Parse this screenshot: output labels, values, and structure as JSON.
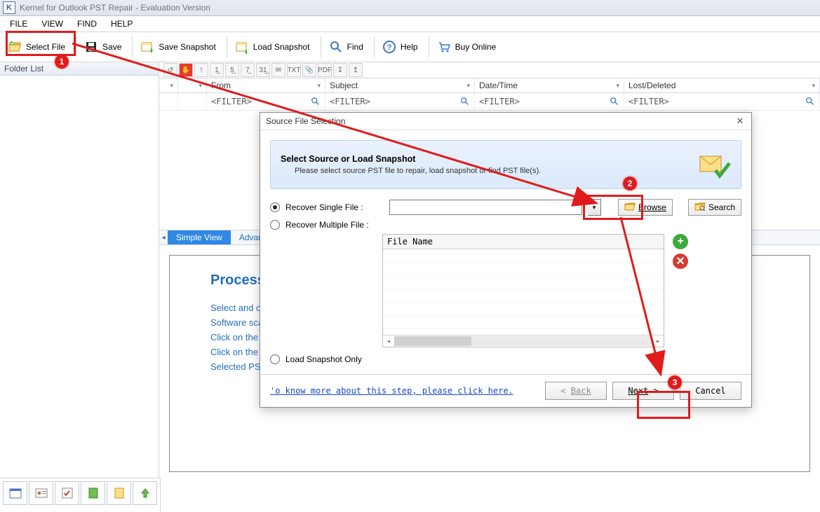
{
  "window": {
    "title": "Kernel for Outlook PST Repair - Evaluation Version",
    "icon_letter": "K"
  },
  "menu": [
    "FILE",
    "VIEW",
    "FIND",
    "HELP"
  ],
  "toolbar": {
    "select_file": "Select File",
    "save": "Save",
    "save_snapshot": "Save Snapshot",
    "load_snapshot": "Load Snapshot",
    "find": "Find",
    "help": "Help",
    "buy_online": "Buy Online"
  },
  "folder_panel": {
    "header": "Folder List"
  },
  "mini_toolbar": [
    "↺",
    "✋",
    "!",
    "1̲",
    "5̲",
    "7̲",
    "31̲",
    "✉",
    "TXT",
    "📎",
    "PDF",
    "↧",
    "↥"
  ],
  "columns": {
    "spacer_a": "",
    "spacer_b": "",
    "from": "From",
    "subject": "Subject",
    "datetime": "Date/Time",
    "lost": "Lost/Deleted"
  },
  "filter_placeholder": "<FILTER>",
  "tabs": {
    "simple": "Simple View",
    "advanced": "Advanced Properties View"
  },
  "process": {
    "title": "Process Information",
    "steps": [
      "Select and click the drive or folder containing PST file.",
      "Software scans the selected source and lists all existing PST files.",
      "Click on the PST file you want to repair.",
      "Click on the Next button to proceed.",
      "Selected PST file(s) will be scanned and listed in tree structure."
    ]
  },
  "modal": {
    "title": "Source File Selection",
    "info_heading": "Select Source or Load Snapshot",
    "info_desc": "Please select source PST file to repair, load snapshot or find PST file(s).",
    "opt_single": "Recover Single File :",
    "opt_multiple": "Recover Multiple File :",
    "opt_snapshot": "Load Snapshot Only",
    "browse": "Browse",
    "search": "Search",
    "file_name_header": "File Name",
    "help_link": "'o know more about this step, please click here.",
    "back": "Back",
    "next": "Next",
    "cancel": "Cancel"
  },
  "callouts": {
    "n1": "1",
    "n2": "2",
    "n3": "3"
  }
}
